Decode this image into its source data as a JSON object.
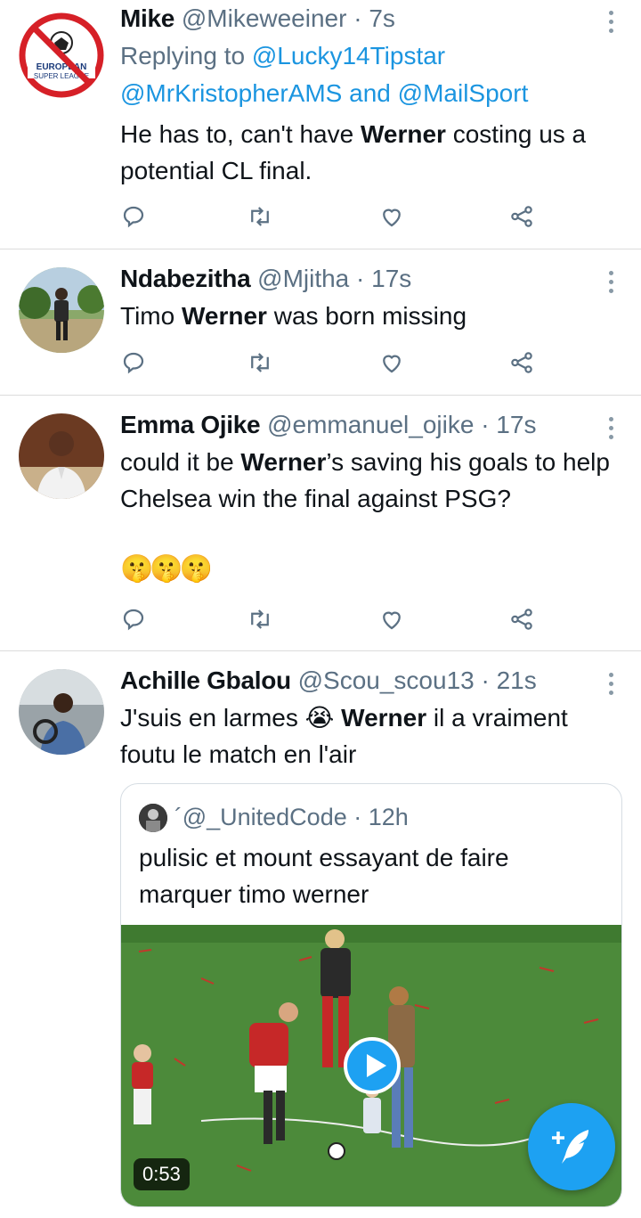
{
  "tweets": [
    {
      "name": "Mike",
      "handle": "@Mikeweeiner",
      "time": "7s",
      "replying_prefix": "Replying to",
      "replying_to_1": "@Lucky14Tipstar",
      "replying_to_2": "@MrKristopherAMS",
      "replying_and": "and",
      "replying_to_3": "@MailSport",
      "text_1": "He has to, can't have ",
      "text_bold": "Werner",
      "text_2": " costing us a potential CL final.",
      "avatar_text_1": "EUROPEAN",
      "avatar_text_2": "SUPER LEAGUE"
    },
    {
      "name": "Ndabezitha",
      "handle": "@Mjitha",
      "time": "17s",
      "text_1": "Timo ",
      "text_bold": "Werner",
      "text_2": " was born missing"
    },
    {
      "name": "Emma Ojike",
      "handle": "@emmanuel_ojike",
      "time": "17s",
      "text_bold": "could it be ",
      "text_bold_word": "Werner",
      "text_2": "’s saving his goals to help Chelsea win the final against PSG?",
      "emojis": "🤫🤫🤫"
    },
    {
      "name": "Achille Gbalou",
      "handle": "@Scou_scou13",
      "time": "21s",
      "text_1": "J'suis en larmes ",
      "emoji": "😭",
      "text_bold": "Werner",
      "text_2": " il a vraiment foutu le match en l'air",
      "quote": {
        "name": "´",
        "handle": "@_UnitedCode",
        "time": "12h",
        "text": "pulisic et mount essayant de faire marquer timo werner",
        "video_duration": "0:53"
      }
    }
  ],
  "separator": "·",
  "colors": {
    "accent": "#1da1f2",
    "link": "#1b95e0",
    "secondary": "#5b7083"
  },
  "icons": [
    "reply-icon",
    "retweet-icon",
    "like-icon",
    "share-icon",
    "more-icon",
    "play-icon",
    "compose-tweet-icon"
  ]
}
